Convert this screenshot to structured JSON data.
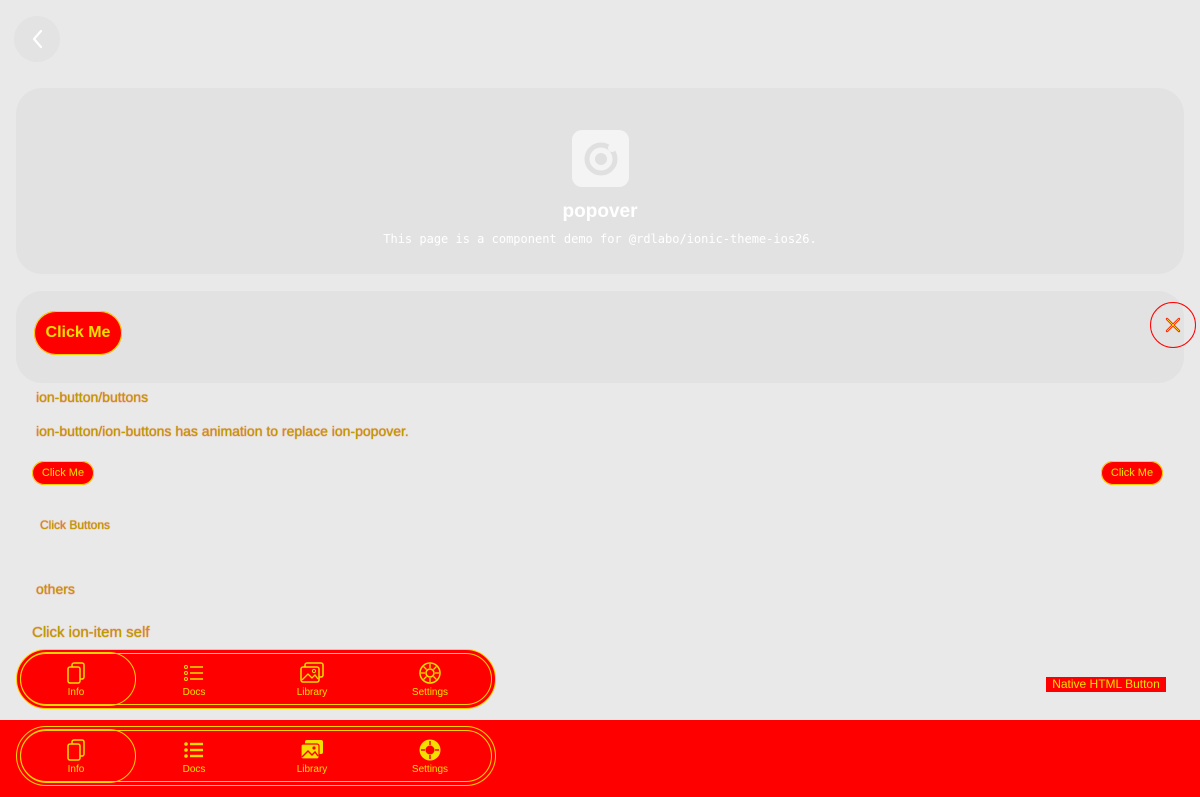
{
  "header": {
    "back_icon": "chevron-left-icon"
  },
  "hero": {
    "logo_icon": "ionic-logo-icon",
    "title": "popover",
    "subtitle": "This page is a component demo for @rdlabo/ionic-theme-ios26."
  },
  "popover_card": {
    "click_label": "Click Me",
    "close_icon": "close-icon"
  },
  "ion_button_section": {
    "heading": "ion-button/buttons",
    "description": "ion-button/ion-buttons has animation to replace ion-popover.",
    "left_button": "Click Me",
    "right_button": "Click Me",
    "click_buttons": "Click Buttons"
  },
  "others_section": {
    "heading": "others",
    "item_label": "Click ion-item self",
    "native_button": "Native HTML Button"
  },
  "tabbar": {
    "tabs": [
      {
        "label": "Info",
        "icon": "copy-icon"
      },
      {
        "label": "Docs",
        "icon": "list-icon"
      },
      {
        "label": "Library",
        "icon": "images-icon"
      },
      {
        "label": "Settings",
        "icon": "gear-icon"
      }
    ]
  },
  "colors": {
    "accent": "#ff0000",
    "highlight": "#f3e000",
    "background": "#e9e9e9"
  }
}
